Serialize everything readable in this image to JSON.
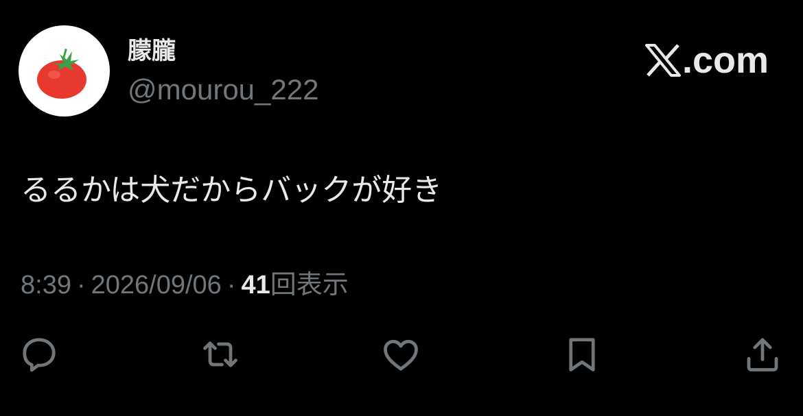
{
  "author": {
    "display_name": "朦朧",
    "handle": "@mourou_222",
    "avatar_icon": "tomato-icon"
  },
  "brand": {
    "icon": "x-logo-icon",
    "suffix": ".com"
  },
  "tweet": {
    "text": "るるかは犬だからバックが好き"
  },
  "meta": {
    "time": "8:39",
    "separator": "·",
    "date": "2026/09/06",
    "views_count": "41",
    "views_label": "回表示"
  },
  "actions": [
    {
      "icon": "reply-icon"
    },
    {
      "icon": "retweet-icon"
    },
    {
      "icon": "like-icon"
    },
    {
      "icon": "bookmark-icon"
    },
    {
      "icon": "share-icon"
    }
  ],
  "colors": {
    "background": "#000000",
    "primary_text": "#e7e9ea",
    "secondary_text": "#71767b",
    "tomato_red": "#e8392f",
    "leaf_green": "#3aa04a"
  }
}
